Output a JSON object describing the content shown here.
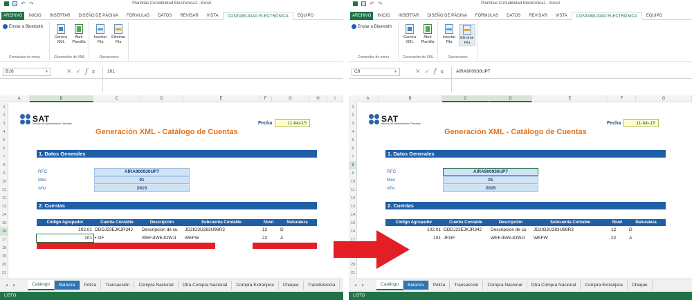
{
  "app": {
    "window_title": "Plantillas Contabilidad Electronica1 - Excel",
    "status_text": "LISTO"
  },
  "ribbon_tabs": [
    "ARCHIVO",
    "INICIO",
    "INSERTAR",
    "DISEÑO DE PÁGINA",
    "FÓRMULAS",
    "DATOS",
    "REVISAR",
    "VISTA",
    "CONTABILIDAD ELECTRÓNICA",
    "EQUIPO"
  ],
  "active_ribbon_tab": "CONTABILIDAD ELECTRÓNICA",
  "ribbon": {
    "bluetooth_button": "Enviar a Bluetooth",
    "groups": {
      "menu_commands": "Comandos de menú",
      "xml_generation": "Generación de XML",
      "operations": "Operaciones"
    },
    "buttons": {
      "generate_xml": "Genera XML",
      "open_template": "Abrir Plantilla",
      "insert_row": "Insertar Fila",
      "delete_row": "Eliminar Fila"
    }
  },
  "sheet_content": {
    "logo_text": "SAT",
    "logo_subtitle": "Servicio de Administración Tributaria",
    "fecha_label": "Fecha",
    "fecha_value": "11-feb-15",
    "main_title": "Generación XML - Catálogo de Cuentas",
    "section1_title": "1. Datos Generales",
    "rfc_label": "RFC",
    "rfc_value": "AIRA900930UP7",
    "mes_label": "Mes",
    "mes_value": "01",
    "anio_label": "Año",
    "anio_value": "2015",
    "section2_title": "2. Cuentas",
    "table_headers": [
      "Código Agrupador",
      "Cuenta Contable",
      "Descripción",
      "Subcuenta Contable",
      "Nivel",
      "Naturaleza"
    ]
  },
  "columns_left": [
    "A",
    "B",
    "C",
    "D",
    "E",
    "F",
    "G",
    "H",
    "I"
  ],
  "columns_right": [
    "A",
    "B",
    "C",
    "D",
    "E",
    "F",
    "G"
  ],
  "sheet_tabs_left": [
    "Catálogo",
    "Balanza",
    "Póliza",
    "Transacción",
    "Compra Nacional",
    "Otra Compra Nacional",
    "Compra Extranjera",
    "Cheque",
    "Transferencia"
  ],
  "sheet_tabs_right": [
    "Catálogo",
    "Balanza",
    "Póliza",
    "Transacción",
    "Compra Nacional",
    "Otra Compra Nacional",
    "Compra Extranjera",
    "Cheque"
  ],
  "left": {
    "name_box": "B16",
    "formula_content": "101",
    "selected_column": "B",
    "selected_row": "16",
    "rows": [
      [
        "102.01",
        "DDDJ23EJKJR34J",
        "Descripcion de cu",
        "JD2IO3U283U98R3",
        "12",
        "D"
      ],
      [
        "101",
        "• I3F",
        "WEFJIWEJOWJI",
        "WEFW",
        "22",
        "A"
      ]
    ]
  },
  "right": {
    "name_box": "C8",
    "formula_content": "AIRA900930UP7",
    "selected_column": "C",
    "selected_row": "8",
    "rows": [
      [
        "102.01",
        "DDDJ23EJKJR34J",
        "Descripcion de cu",
        "JD2IO3U283U98R3",
        "12",
        "D"
      ],
      [
        "101",
        "JFI3F",
        "WEFJIWEJOWJI",
        "WEFW",
        "22",
        "A"
      ]
    ]
  },
  "colors": {
    "excel_green": "#217346",
    "header_blue": "#1f5fa8",
    "title_orange": "#e07420",
    "highlight_red": "#e31e24",
    "field_fill": "#cfe3f6"
  }
}
